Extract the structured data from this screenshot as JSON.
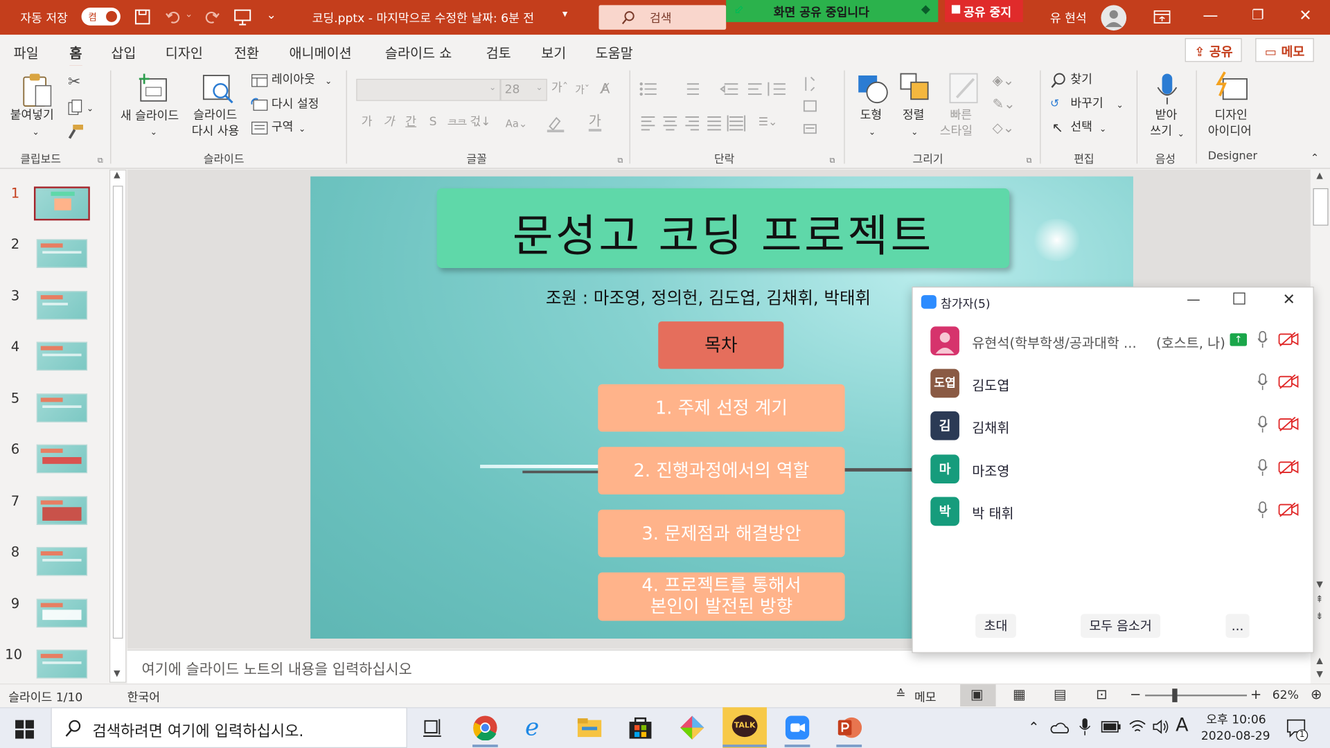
{
  "titlebar": {
    "autosave_label": "자동 저장",
    "autosave_state": "켬",
    "doc_title": "코딩.pptx  -  마지막으로 수정한 날짜: 6분 전",
    "search_placeholder": "검색",
    "sharing_banner": "화면 공유 중입니다",
    "stop_share": "공유 중지",
    "user_name": "유 현석"
  },
  "menu": {
    "tabs": [
      "파일",
      "홈",
      "삽입",
      "디자인",
      "전환",
      "애니메이션",
      "슬라이드 쇼",
      "검토",
      "보기",
      "도움말"
    ],
    "share": "공유",
    "comments": "메모"
  },
  "ribbon": {
    "clipboard": {
      "paste": "붙여넣기",
      "group": "클립보드"
    },
    "slides": {
      "new_slide": "새 슬라이드",
      "reuse_1": "슬라이드",
      "reuse_2": "다시 사용",
      "layout": "레이아웃",
      "reset": "다시 설정",
      "section": "구역",
      "group": "슬라이드"
    },
    "font": {
      "size": "28",
      "group": "글꼴",
      "row2": [
        "가",
        "가",
        "간",
        "S",
        "ᄏᄏ",
        "걳↓"
      ]
    },
    "paragraph": {
      "group": "단락"
    },
    "drawing": {
      "shapes": "도형",
      "arrange": "정렬",
      "quick_1": "빠른",
      "quick_2": "스타일",
      "group": "그리기"
    },
    "editing": {
      "find": "찾기",
      "replace": "바꾸기",
      "select": "선택",
      "group": "편집"
    },
    "voice": {
      "dictate_1": "받아",
      "dictate_2": "쓰기",
      "group": "음성"
    },
    "designer": {
      "ideas_1": "디자인",
      "ideas_2": "아이디어",
      "group": "Designer"
    }
  },
  "thumbnails": [
    "1",
    "2",
    "3",
    "4",
    "5",
    "6",
    "7",
    "8",
    "9",
    "10"
  ],
  "slide": {
    "title": "문성고 코딩 프로젝트",
    "members": "조원 : 마조영, 정의헌, 김도엽, 김채휘, 박태휘",
    "toc": "목차",
    "items": [
      "1. 주제 선정 계기",
      "2. 진행과정에서의 역할",
      "3. 문제점과 해결방안",
      "4. 프로젝트를 통해서",
      "본인이 발전된 방향"
    ]
  },
  "notes_placeholder": "여기에 슬라이드 노트의 내용을 입력하십시오",
  "statusbar": {
    "slide_pos": "슬라이드 1/10",
    "language": "한국어",
    "notes": "메모",
    "zoom": "62%"
  },
  "participants": {
    "title": "참가자(5)",
    "list": [
      {
        "name": "유현석(학부학생/공과대학 ...",
        "tag": "(호스트, 나)",
        "avatar": "",
        "color": "#d6336c"
      },
      {
        "name": "김도엽",
        "avatar": "도엽",
        "color": "#8a5a44"
      },
      {
        "name": "김채휘",
        "avatar": "김",
        "color": "#2b3a55"
      },
      {
        "name": "마조영",
        "avatar": "마",
        "color": "#169c7c"
      },
      {
        "name": "박 태휘",
        "avatar": "박",
        "color": "#169c7c"
      }
    ],
    "invite": "초대",
    "mute_all": "모두 음소거",
    "more": "..."
  },
  "taskbar": {
    "search_placeholder": "검색하려면 여기에 입력하십시오.",
    "time": "오후 10:06",
    "date": "2020-08-29",
    "ime": "A",
    "notif_count": "1",
    "kakao": "TALK"
  }
}
